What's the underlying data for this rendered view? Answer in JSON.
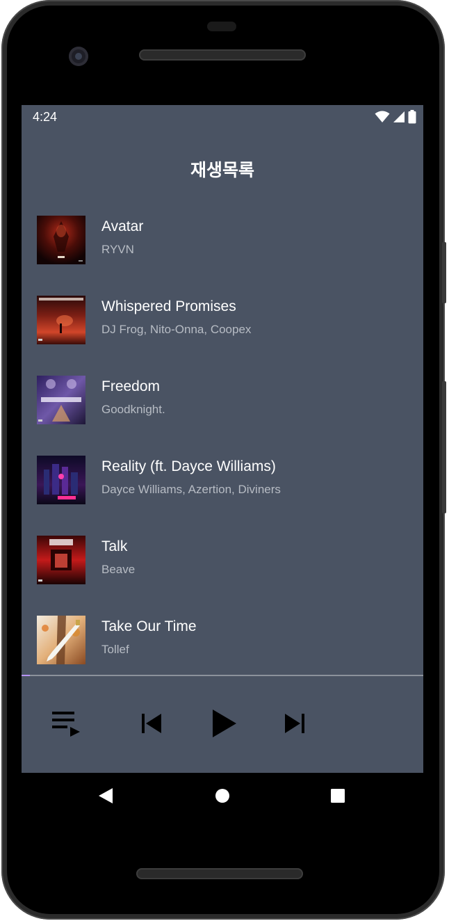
{
  "status_bar": {
    "time": "4:24",
    "icons": [
      "wifi-icon",
      "cellular-signal-icon",
      "battery-icon"
    ]
  },
  "header": {
    "title": "재생목록"
  },
  "tracks": [
    {
      "title": "Avatar",
      "artist": "RYVN"
    },
    {
      "title": "Whispered Promises",
      "artist": "DJ Frog, Nito-Onna, Coopex"
    },
    {
      "title": "Freedom",
      "artist": "Goodknight."
    },
    {
      "title": "Reality (ft. Dayce Williams)",
      "artist": "Dayce Williams, Azertion, Diviners"
    },
    {
      "title": "Talk",
      "artist": "Beave"
    },
    {
      "title": "Take Our Time",
      "artist": "Tollef"
    }
  ],
  "player": {
    "progress": 0.02,
    "controls": [
      "queue-icon",
      "skip-previous-icon",
      "play-icon",
      "skip-next-icon"
    ]
  },
  "nav": {
    "buttons": [
      "back-icon",
      "home-icon",
      "recents-icon"
    ]
  },
  "colors": {
    "background": "#4a5363",
    "accent": "#b794f6",
    "secondary_text": "#b7bcc4"
  }
}
